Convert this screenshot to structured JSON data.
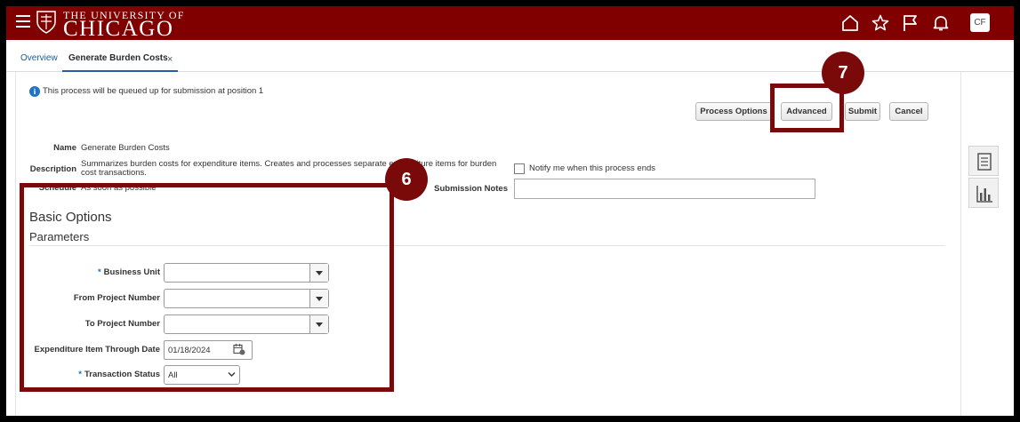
{
  "header": {
    "logo_line1": "THE UNIVERSITY OF",
    "logo_line2": "CHICAGO",
    "avatar_initials": "CF",
    "background": "#800000"
  },
  "tabs": [
    {
      "label": "Overview",
      "active": false
    },
    {
      "label": "Generate Burden Costs",
      "active": true,
      "close": "×"
    }
  ],
  "info": {
    "icon": "info-icon",
    "text": "This process will be queued up for submission at position 1"
  },
  "buttons": {
    "process_options": "Process Options",
    "advanced": "Advanced",
    "submit": "Submit",
    "cancel": "Cancel"
  },
  "details": {
    "name_label": "Name",
    "name_value": "Generate Burden Costs",
    "description_label": "Description",
    "description_value": "Summarizes burden costs for expenditure items. Creates and processes separate expenditure items for burden cost transactions.",
    "schedule_label": "Schedule",
    "schedule_value": "As soon as possible",
    "notify_label": "Notify me when this process ends",
    "submission_notes_label": "Submission Notes"
  },
  "basic_options": {
    "heading": "Basic Options",
    "subheading": "Parameters",
    "required_marker": "*",
    "business_unit_label": "Business Unit",
    "from_project_label": "From Project Number",
    "to_project_label": "To Project Number",
    "expenditure_date_label": "Expenditure Item Through Date",
    "expenditure_date_value": "01/18/2024",
    "transaction_status_label": "Transaction Status",
    "transaction_status_value": "All"
  },
  "callouts": {
    "step6": "6",
    "step7": "7",
    "color": "#7a0a0a"
  }
}
